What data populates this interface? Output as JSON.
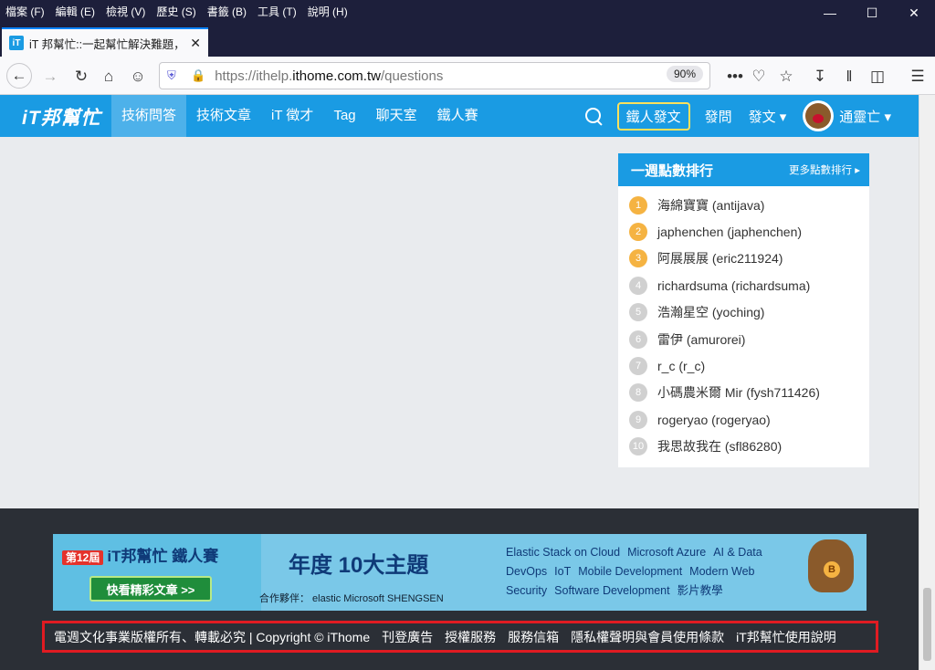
{
  "menubar": {
    "items": [
      "檔案 (F)",
      "編輯 (E)",
      "檢視 (V)",
      "歷史 (S)",
      "書籤 (B)",
      "工具 (T)",
      "說明 (H)"
    ],
    "minimize": "—",
    "maximize": "☐",
    "close": "✕"
  },
  "tab": {
    "title": "iT 邦幫忙::一起幫忙解決難題，",
    "close": "✕",
    "new_tab": "+"
  },
  "navbar": {
    "url_prefix": "https://ithelp.",
    "url_domain": "ithome.com.tw",
    "url_path": "/questions",
    "zoom": "90%"
  },
  "site": {
    "logo": "iT邦幫忙",
    "nav": [
      "技術問答",
      "技術文章",
      "iT 徵才",
      "Tag",
      "聊天室",
      "鐵人賽"
    ],
    "ironman_post": "鐵人發文",
    "ask": "發問",
    "post": "發文 ▾",
    "username": "通靈亡 ▾"
  },
  "ranking": {
    "title": "一週點數排行",
    "more": "更多點數排行 ▸",
    "items": [
      {
        "rank": "1",
        "name": "海綿寶寶 (antijava)"
      },
      {
        "rank": "2",
        "name": "japhenchen (japhenchen)"
      },
      {
        "rank": "3",
        "name": "阿展展展 (eric211924)"
      },
      {
        "rank": "4",
        "name": "richardsuma (richardsuma)"
      },
      {
        "rank": "5",
        "name": "浩瀚星空 (yoching)"
      },
      {
        "rank": "6",
        "name": "雷伊 (amurorei)"
      },
      {
        "rank": "7",
        "name": "r_c (r_c)"
      },
      {
        "rank": "8",
        "name": "小碼農米爾 Mir (fysh711426)"
      },
      {
        "rank": "9",
        "name": "rogeryao (rogeryao)"
      },
      {
        "rank": "10",
        "name": "我思故我在 (sfl86280)"
      }
    ]
  },
  "banner": {
    "badge": "第12屆",
    "title": "iT邦幫忙 鐵人賽",
    "button": "快看精彩文章 >>",
    "headline": "年度 10大主題",
    "partners": "合作夥伴： elastic  Microsoft  SHENGSEN",
    "topics": [
      "Elastic Stack on Cloud",
      "Microsoft Azure",
      "AI & Data",
      "DevOps",
      "IoT",
      "Mobile Development",
      "Modern Web",
      "Security",
      "Software Development",
      "影片教學"
    ]
  },
  "footer": {
    "links": [
      "電週文化事業版權所有、轉載必究 | Copyright © iThome",
      "刊登廣告",
      "授權服務",
      "服務信箱",
      "隱私權聲明與會員使用條款",
      "iT邦幫忙使用說明"
    ]
  }
}
